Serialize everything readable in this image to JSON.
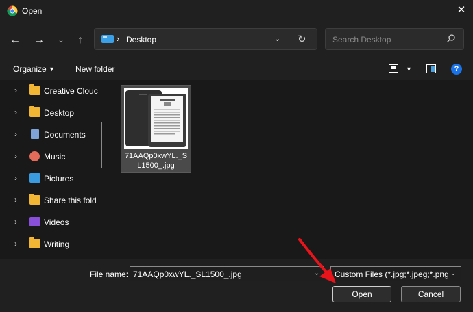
{
  "window": {
    "title": "Open",
    "app_icon": "chrome-icon",
    "close_icon": "close-icon"
  },
  "nav": {
    "back_icon": "arrow-left-icon",
    "forward_icon": "arrow-right-icon",
    "recent_icon": "chevron-down-icon",
    "up_icon": "arrow-up-icon",
    "address": {
      "location": "Desktop",
      "separator": "›"
    },
    "search_placeholder": "Search Desktop"
  },
  "toolbar": {
    "organize_label": "Organize",
    "new_folder_label": "New folder",
    "help_label": "?"
  },
  "sidebar": {
    "items": [
      {
        "label": "Creative Clouc",
        "icon": "folder-icon"
      },
      {
        "label": "Desktop",
        "icon": "folder-icon"
      },
      {
        "label": "Documents",
        "icon": "documents-icon"
      },
      {
        "label": "Music",
        "icon": "music-icon"
      },
      {
        "label": "Pictures",
        "icon": "pictures-icon"
      },
      {
        "label": "Share this fold",
        "icon": "folder-icon"
      },
      {
        "label": "Videos",
        "icon": "videos-icon"
      },
      {
        "label": "Writing",
        "icon": "folder-icon"
      }
    ]
  },
  "files": [
    {
      "name": "71AAQp0xwYL._SL1500_.jpg",
      "selected": true
    }
  ],
  "footer": {
    "file_name_label": "File name:",
    "file_name_value": "71AAQp0xwYL._SL1500_.jpg",
    "file_type_value": "Custom Files (*.jpg;*.jpeg;*.png",
    "open_label": "Open",
    "cancel_label": "Cancel"
  },
  "colors": {
    "accent": "#1a73e8",
    "annotation_arrow": "#e8141b",
    "folder": "#f2b634"
  }
}
